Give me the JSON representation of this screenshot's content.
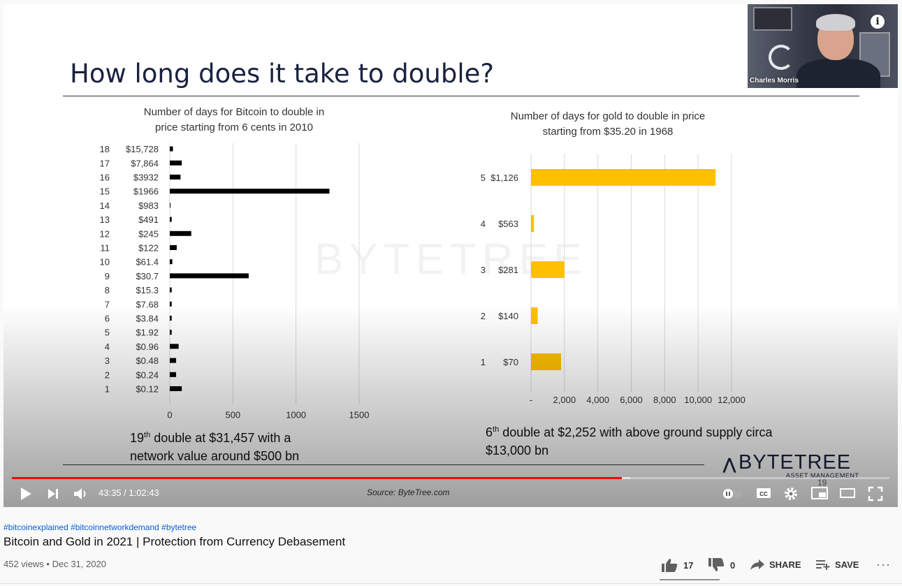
{
  "slide": {
    "title": "How long does it take to double?",
    "watermark": "BYTETREE",
    "slide_number": "19",
    "source": "Source: ByteTree.com",
    "logo": {
      "name": "BYTETREE",
      "subtitle": "ASSET MANAGEMENT"
    },
    "note_left": {
      "ordinal_num": "19",
      "ordinal_suffix": "th",
      "text_line1": " double at $31,457 with a",
      "text_line2": "network value around $500 bn"
    },
    "note_right": {
      "ordinal_num": "6",
      "ordinal_suffix": "th",
      "text_line1": " double at $2,252 with above ground supply circa",
      "text_line2": "$13,000 bn"
    }
  },
  "webcam": {
    "name": "Charles Morris"
  },
  "player": {
    "current_time": "43:35",
    "duration": "1:02:43",
    "time_separator": " / ",
    "progress_played_fraction": 0.695,
    "progress_buffered_fraction": 0.705
  },
  "video": {
    "hashtags": "#bitcoinexplained #bitcoinnetworkdemand #bytetree",
    "title": "Bitcoin and Gold in 2021 | Protection from Currency Debasement",
    "views": "452 views",
    "date": "Dec 31, 2020",
    "meta_separator": " • ",
    "likes": "17",
    "dislikes": "0",
    "share_label": "SHARE",
    "save_label": "SAVE"
  },
  "chart_data": [
    {
      "type": "bar",
      "orientation": "horizontal",
      "title_line1": "Number of days for Bitcoin to double in",
      "title_line2": "price starting from 6 cents in 2010",
      "color": "#000000",
      "xlim": [
        0,
        1500
      ],
      "xticks": [
        "0",
        "500",
        "1000",
        "1500"
      ],
      "xtick_values": [
        0,
        500,
        1000,
        1500
      ],
      "categories": [
        {
          "num": "18",
          "price": "$15,728"
        },
        {
          "num": "17",
          "price": "$7,864"
        },
        {
          "num": "16",
          "price": "$3932"
        },
        {
          "num": "15",
          "price": "$1966"
        },
        {
          "num": "14",
          "price": "$983"
        },
        {
          "num": "13",
          "price": "$491"
        },
        {
          "num": "12",
          "price": "$245"
        },
        {
          "num": "11",
          "price": "$122"
        },
        {
          "num": "10",
          "price": "$61.4"
        },
        {
          "num": "9",
          "price": "$30.7"
        },
        {
          "num": "8",
          "price": "$15.3"
        },
        {
          "num": "7",
          "price": "$7.68"
        },
        {
          "num": "6",
          "price": "$3.84"
        },
        {
          "num": "5",
          "price": "$1.92"
        },
        {
          "num": "4",
          "price": "$0.96"
        },
        {
          "num": "3",
          "price": "$0.48"
        },
        {
          "num": "2",
          "price": "$0.24"
        },
        {
          "num": "1",
          "price": "$0.12"
        }
      ],
      "values": [
        25,
        95,
        85,
        1265,
        5,
        15,
        170,
        55,
        20,
        625,
        15,
        15,
        15,
        15,
        70,
        50,
        50,
        95
      ]
    },
    {
      "type": "bar",
      "orientation": "horizontal",
      "title_line1": "Number of days for gold to double in price",
      "title_line2": "starting from $35.20 in 1968",
      "color": "#ffc000",
      "xlim": [
        0,
        12000
      ],
      "xticks": [
        "-",
        "2,000",
        "4,000",
        "6,000",
        "8,000",
        "10,000",
        "12,000"
      ],
      "xtick_values": [
        0,
        2000,
        4000,
        6000,
        8000,
        10000,
        12000
      ],
      "categories": [
        {
          "num": "5",
          "price": "$1,126"
        },
        {
          "num": "4",
          "price": "$563"
        },
        {
          "num": "3",
          "price": "$281"
        },
        {
          "num": "2",
          "price": "$140"
        },
        {
          "num": "1",
          "price": "$70"
        }
      ],
      "values": [
        11050,
        180,
        2000,
        400,
        1800
      ]
    }
  ]
}
